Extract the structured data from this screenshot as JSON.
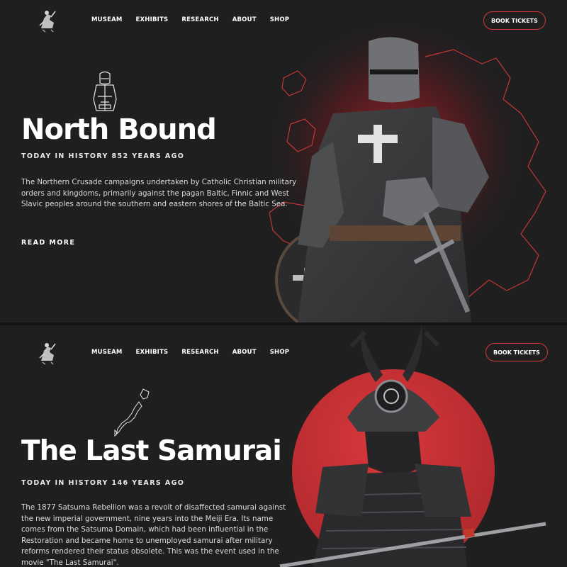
{
  "nav": {
    "items": [
      "MUSEAM",
      "EXHIBITS",
      "RESEARCH",
      "ABOUT",
      "SHOP"
    ],
    "cta": "BOOK TICKETS"
  },
  "crusade": {
    "title": "North Bound",
    "today": "TODAY IN HISTORY 852 YEARS AGO",
    "description": "The Northern Crusade campaigns undertaken by Catholic Christian military orders and kingdoms, primarily against the pagan Baltic, Finnic and West Slavic peoples around the southern and eastern shores of the Baltic Sea.",
    "read_more": "READ MORE"
  },
  "samurai": {
    "title": "The Last Samurai",
    "today": "TODAY IN HISTORY 146 YEARS AGO",
    "description": "The 1877 Satsuma Rebellion was a revolt of disaffected samurai against the new imperial government, nine years into the Meiji Era. Its name comes from the Satsuma Domain, which had been influential in the Restoration and became home to unemployed samurai after military reforms rendered their status obsolete. This was the event used in the movie \"The Last Samurai\"."
  },
  "colors": {
    "background": "#1f1f20",
    "accent": "#d5383b",
    "text": "#ffffff"
  },
  "icons": [
    "knight-logo-icon",
    "knight-outline-icon",
    "europe-map-outline",
    "japan-map-icon"
  ]
}
